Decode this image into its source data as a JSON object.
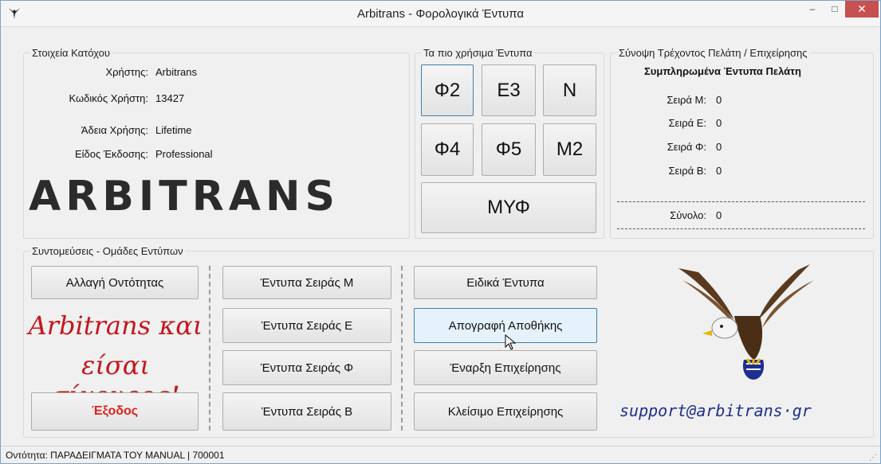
{
  "window": {
    "title": "Arbitrans - Φορολογικά Έντυπα",
    "minimize": "–",
    "maximize": "□",
    "close": "✕"
  },
  "owner": {
    "group_label": "Στοιχεία Κατόχου",
    "user_label": "Χρήστης:",
    "user_value": "Arbitrans",
    "code_label": "Κωδικός Χρήστη:",
    "code_value": "13427",
    "license_label": "Άδεια Χρήσης:",
    "license_value": "Lifetime",
    "edition_label": "Είδος Έκδοσης:",
    "edition_value": "Professional",
    "logo_text": "ARBITRANS"
  },
  "forms": {
    "group_label": "Τα πιο χρήσιμα Έντυπα",
    "f2": "Φ2",
    "e3": "Ε3",
    "n": "Ν",
    "f4": "Φ4",
    "f5": "Φ5",
    "m2": "Μ2",
    "myf": "ΜΥΦ"
  },
  "summary": {
    "group_label": "Σύνοψη Τρέχοντος Πελάτη / Επιχείρησης",
    "header": "Συμπληρωμένα Έντυπα Πελάτη",
    "series_m_label": "Σειρά Μ:",
    "series_m_value": "0",
    "series_e_label": "Σειρά Ε:",
    "series_e_value": "0",
    "series_f_label": "Σειρά Φ:",
    "series_f_value": "0",
    "series_b_label": "Σειρά Β:",
    "series_b_value": "0",
    "total_label": "Σύνολο:",
    "total_value": "0"
  },
  "shortcuts": {
    "group_label": "Συντομεύσεις - Ομάδες Εντύπων",
    "change_identity": "Αλλαγή Οντότητας",
    "slogan_line1": "Arbitrans και",
    "slogan_line2": "είσαι σίγουρος!",
    "exit": "Έξοδος",
    "series_m": "Έντυπα Σειράς Μ",
    "series_e": "Έντυπα Σειράς Ε",
    "series_f": "Έντυπα Σειράς Φ",
    "series_b": "Έντυπα Σειράς Β",
    "special": "Ειδικά Έντυπα",
    "inventory": "Απογραφή Αποθήκης",
    "business_start": "Έναρξη Επιχείρησης",
    "business_close": "Κλείσιμο Επιχείρησης",
    "support_email": "support@arbitrans·gr"
  },
  "status": {
    "text": "Οντότητα:  ΠΑΡΑΔΕΙΓΜΑΤΑ ΤΟΥ MANUAL  |  700001"
  },
  "colors": {
    "accent_red": "#c4161c",
    "support_blue": "#1d2f8f",
    "close_red": "#c75050"
  }
}
